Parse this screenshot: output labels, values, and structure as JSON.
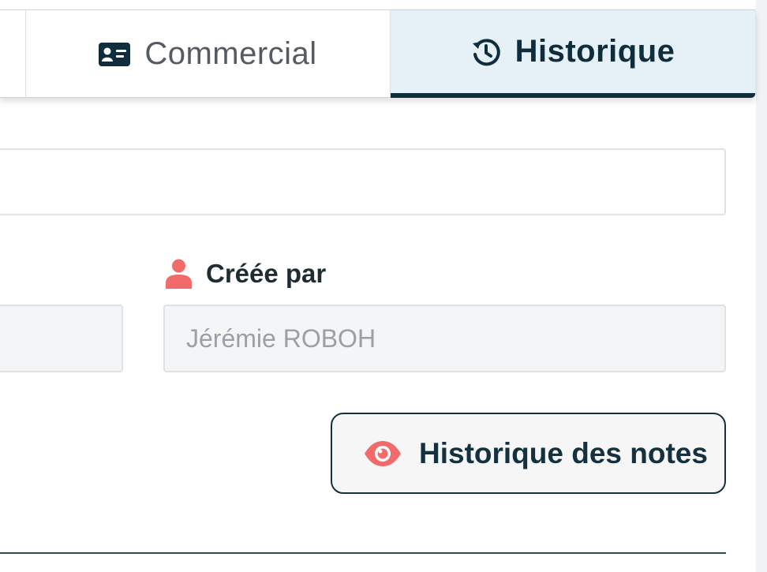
{
  "tabs": [
    {
      "label": "Commercial",
      "icon": "id-card-icon",
      "active": false
    },
    {
      "label": "Historique",
      "icon": "history-icon",
      "active": true
    }
  ],
  "form": {
    "created_by_label": "Créée par",
    "created_by_value": "Jérémie ROBOH",
    "created_by_icon": "user-icon"
  },
  "actions": {
    "notes_history_label": "Historique des notes",
    "notes_history_icon": "eye-icon"
  },
  "colors": {
    "primary": "#0f2d3d",
    "accent": "#f26b6b",
    "active_tab_bg": "#e6f0f7"
  }
}
